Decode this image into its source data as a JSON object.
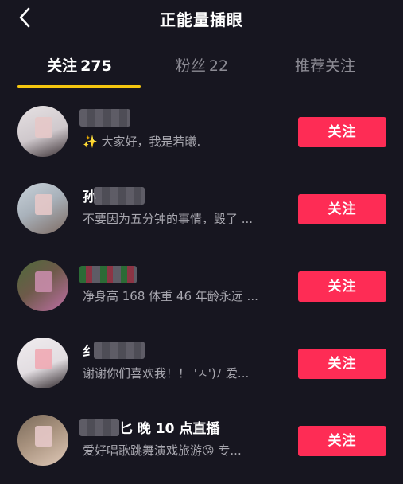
{
  "header": {
    "title": "正能量插眼"
  },
  "tabs": [
    {
      "label": "关注",
      "count": "275",
      "active": true
    },
    {
      "label": "粉丝",
      "count": "22",
      "active": false
    },
    {
      "label": "推荐关注",
      "count": "",
      "active": false
    }
  ],
  "users": [
    {
      "name_visible": "",
      "desc": "✨ 大家好，我是若曦.",
      "follow_label": "关注",
      "avatar_colors": [
        "#d9d4d6",
        "#3a3034"
      ]
    },
    {
      "name_visible": "孙",
      "desc": "不要因为五分钟的事情，毁了 ...",
      "follow_label": "关注",
      "avatar_colors": [
        "#b8c2cc",
        "#7d6a62"
      ]
    },
    {
      "name_visible": "",
      "desc": "净身高 168 体重 46 年龄永远 ...",
      "follow_label": "关注",
      "avatar_colors": [
        "#4e6a3a",
        "#c06fa6"
      ]
    },
    {
      "name_visible": "纟",
      "desc": "谢谢你们喜欢我！！ 'ㅅ')ﾉ 爱...",
      "follow_label": "关注",
      "avatar_colors": [
        "#eae6ea",
        "#2a2226"
      ]
    },
    {
      "name_visible": "匕 晚 10 点直播",
      "desc": "爱好唱歌跳舞演戏旅游😘 专...",
      "follow_label": "关注",
      "avatar_colors": [
        "#8c7a66",
        "#e0c9b8"
      ]
    }
  ],
  "colors": {
    "accent": "#f5c60f",
    "follow": "#fe2c55",
    "background": "#171620"
  },
  "icons": {
    "back": "chevron-left-icon"
  }
}
